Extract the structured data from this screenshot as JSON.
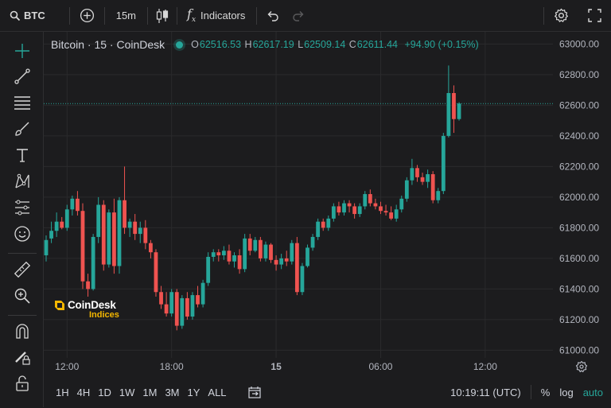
{
  "toolbar": {
    "symbol": "BTC",
    "interval": "15m",
    "indicators_label": "Indicators",
    "icons": [
      "search-icon",
      "add-icon",
      "candles-icon",
      "function-icon",
      "undo-icon",
      "redo-icon",
      "settings-icon",
      "fullscreen-icon"
    ]
  },
  "sidebar": {
    "tools": [
      "crosshair-icon",
      "trend-line-icon",
      "fib-lines-icon",
      "brush-icon",
      "text-icon",
      "pattern-icon",
      "prediction-icon",
      "emoji-icon",
      "ruler-icon",
      "zoom-in-icon",
      "magnet-icon",
      "lock-drawing-icon",
      "unlock-icon"
    ]
  },
  "legend": {
    "symbol_title": "Bitcoin · 15 · CoinDesk",
    "open_key": "O",
    "open": "62516.53",
    "high_key": "H",
    "high": "62617.19",
    "low_key": "L",
    "low": "62509.14",
    "close_key": "C",
    "close": "62611.44",
    "change": "+94.90 (+0.15%)"
  },
  "logo": {
    "line1": "CoinDesk",
    "line2": "Indices"
  },
  "bottom": {
    "ranges": [
      "1H",
      "4H",
      "1D",
      "1W",
      "1M",
      "3M",
      "1Y",
      "ALL"
    ],
    "time": "10:19:11 (UTC)",
    "percent_label": "%",
    "log_label": "log",
    "auto_label": "auto"
  },
  "colors": {
    "up": "#26a69a",
    "down": "#ef5350",
    "background": "#1c1c1e",
    "grid": "#2a2a2c",
    "accent": "#26a69a"
  },
  "chart_data": {
    "type": "candlestick",
    "title": "Bitcoin · 15 · CoinDesk",
    "ylim": [
      60950,
      63080
    ],
    "yticks": [
      63000,
      62800,
      62600,
      62400,
      62200,
      62000,
      61800,
      61600,
      61400,
      61200,
      61000
    ],
    "ytick_labels": [
      "63000.00",
      "62800.00",
      "62600.00",
      "62400.00",
      "62200.00",
      "62000.00",
      "61800.00",
      "61600.00",
      "61400.00",
      "61200.00",
      "61000.00"
    ],
    "xtick_labels": [
      {
        "index": 4,
        "label": "12:00"
      },
      {
        "index": 24,
        "label": "18:00"
      },
      {
        "index": 44,
        "label": "15"
      },
      {
        "index": 64,
        "label": "06:00"
      },
      {
        "index": 84,
        "label": "12:00"
      }
    ],
    "current_price": 62611.44,
    "grid": true,
    "candles": [
      [
        61620,
        61750,
        61580,
        61720
      ],
      [
        61730,
        61840,
        61700,
        61780
      ],
      [
        61780,
        61900,
        61740,
        61840
      ],
      [
        61840,
        61870,
        61790,
        61800
      ],
      [
        61800,
        61950,
        61780,
        61920
      ],
      [
        61920,
        62010,
        61880,
        61990
      ],
      [
        61990,
        62040,
        61880,
        61910
      ],
      [
        61910,
        61960,
        61400,
        61450
      ],
      [
        61450,
        61500,
        61350,
        61400
      ],
      [
        61400,
        61760,
        61390,
        61740
      ],
      [
        61740,
        62000,
        61700,
        61950
      ],
      [
        61950,
        61980,
        61520,
        61560
      ],
      [
        61560,
        61920,
        61540,
        61900
      ],
      [
        61900,
        61990,
        61500,
        61550
      ],
      [
        61550,
        62000,
        61500,
        61980
      ],
      [
        61980,
        62200,
        61760,
        61800
      ],
      [
        61800,
        61860,
        61740,
        61840
      ],
      [
        61840,
        61890,
        61720,
        61760
      ],
      [
        61760,
        61840,
        61700,
        61800
      ],
      [
        61800,
        61850,
        61660,
        61700
      ],
      [
        61700,
        61720,
        61600,
        61640
      ],
      [
        61640,
        61660,
        61350,
        61380
      ],
      [
        61380,
        61420,
        61270,
        61300
      ],
      [
        61300,
        61380,
        61220,
        61240
      ],
      [
        61240,
        61400,
        61220,
        61380
      ],
      [
        61380,
        61400,
        61130,
        61160
      ],
      [
        61160,
        61360,
        61140,
        61340
      ],
      [
        61340,
        61380,
        61200,
        61220
      ],
      [
        61220,
        61380,
        61200,
        61360
      ],
      [
        61360,
        61420,
        61280,
        61300
      ],
      [
        61300,
        61460,
        61280,
        61440
      ],
      [
        61440,
        61640,
        61420,
        61610
      ],
      [
        61610,
        61660,
        61580,
        61640
      ],
      [
        61640,
        61660,
        61580,
        61620
      ],
      [
        61620,
        61680,
        61590,
        61650
      ],
      [
        61650,
        61690,
        61560,
        61580
      ],
      [
        61580,
        61640,
        61540,
        61620
      ],
      [
        61620,
        61660,
        61500,
        61530
      ],
      [
        61530,
        61760,
        61510,
        61730
      ],
      [
        61730,
        61760,
        61620,
        61650
      ],
      [
        61650,
        61740,
        61640,
        61720
      ],
      [
        61720,
        61740,
        61580,
        61600
      ],
      [
        61600,
        61710,
        61580,
        61690
      ],
      [
        61690,
        61700,
        61570,
        61590
      ],
      [
        61590,
        61620,
        61520,
        61560
      ],
      [
        61560,
        61630,
        61530,
        61600
      ],
      [
        61600,
        61650,
        61550,
        61580
      ],
      [
        61580,
        61720,
        61560,
        61700
      ],
      [
        61700,
        61740,
        61360,
        61380
      ],
      [
        61380,
        61570,
        61360,
        61550
      ],
      [
        61550,
        61690,
        61540,
        61670
      ],
      [
        61670,
        61760,
        61650,
        61740
      ],
      [
        61740,
        61860,
        61720,
        61840
      ],
      [
        61840,
        61860,
        61780,
        61800
      ],
      [
        61800,
        61880,
        61780,
        61860
      ],
      [
        61860,
        61960,
        61840,
        61940
      ],
      [
        61940,
        61970,
        61880,
        61900
      ],
      [
        61900,
        61980,
        61880,
        61960
      ],
      [
        61960,
        61980,
        61900,
        61940
      ],
      [
        61940,
        61960,
        61860,
        61890
      ],
      [
        61890,
        61960,
        61870,
        61940
      ],
      [
        61940,
        62040,
        61920,
        62020
      ],
      [
        62020,
        62050,
        61940,
        61960
      ],
      [
        61960,
        61990,
        61920,
        61940
      ],
      [
        61940,
        61970,
        61890,
        61910
      ],
      [
        61910,
        61950,
        61880,
        61900
      ],
      [
        61900,
        61940,
        61850,
        61860
      ],
      [
        61860,
        61950,
        61840,
        61920
      ],
      [
        61920,
        62010,
        61900,
        61990
      ],
      [
        61990,
        62130,
        61970,
        62110
      ],
      [
        62110,
        62250,
        62080,
        62190
      ],
      [
        62190,
        62210,
        62100,
        62130
      ],
      [
        62130,
        62160,
        62080,
        62100
      ],
      [
        62100,
        62180,
        62060,
        62150
      ],
      [
        62150,
        62170,
        61960,
        61980
      ],
      [
        61980,
        62060,
        61960,
        62040
      ],
      [
        62040,
        62420,
        62020,
        62400
      ],
      [
        62400,
        62860,
        62390,
        62680
      ],
      [
        62680,
        62730,
        62420,
        62510
      ],
      [
        62510,
        62620,
        62500,
        62611.44
      ]
    ]
  }
}
